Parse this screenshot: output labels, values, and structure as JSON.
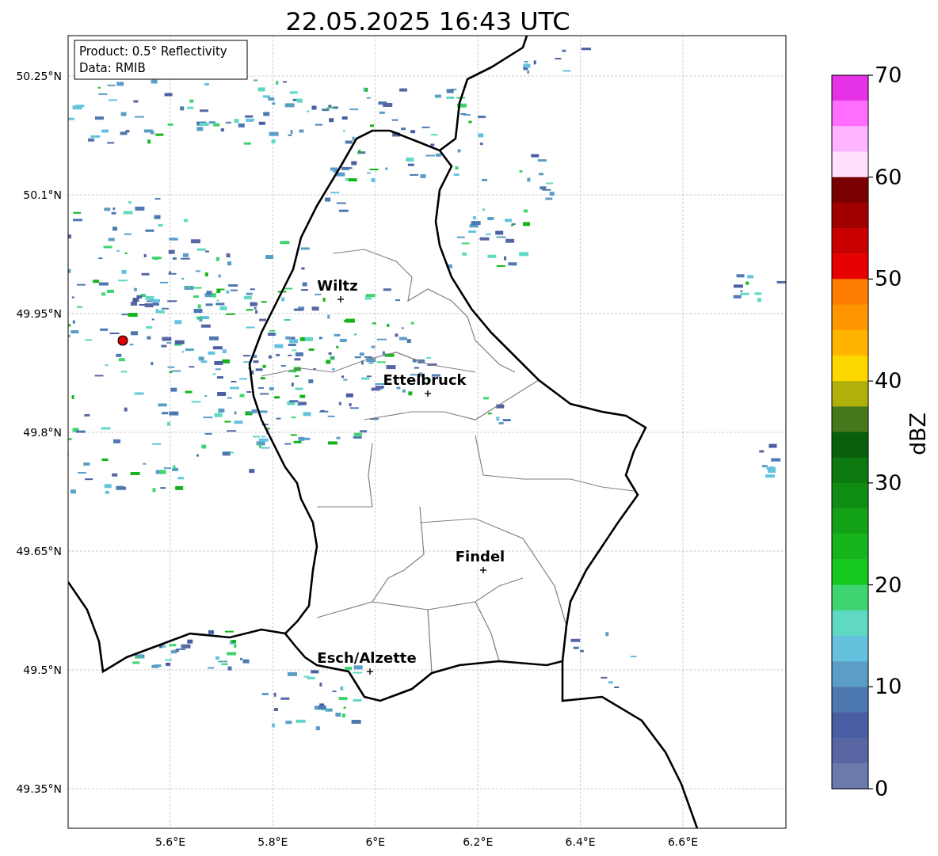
{
  "title": "22.05.2025 16:43 UTC",
  "info_box": [
    "Product: 0.5° Reflectivity",
    "Data: RMIB"
  ],
  "lat_labels": [
    "50.25°N",
    "50.1°N",
    "49.95°N",
    "49.8°N",
    "49.65°N",
    "49.5°N",
    "49.35°N"
  ],
  "lon_labels": [
    "5.6°E",
    "5.8°E",
    "6°E",
    "6.2°E",
    "6.4°E",
    "6.6°E"
  ],
  "cities": [
    {
      "name": "Wiltz"
    },
    {
      "name": "Ettelbruck"
    },
    {
      "name": "Findel"
    },
    {
      "name": "Esch/Alzette"
    }
  ],
  "colorbar": {
    "label": "dBZ",
    "ticks": [
      "70",
      "60",
      "50",
      "40",
      "30",
      "20",
      "10",
      "0"
    ],
    "bands": [
      {
        "color": "#e632e6"
      },
      {
        "color": "#ff6eff"
      },
      {
        "color": "#ffb4ff"
      },
      {
        "color": "#ffe0ff"
      },
      {
        "color": "#780000"
      },
      {
        "color": "#a00000"
      },
      {
        "color": "#c80000"
      },
      {
        "color": "#e60000"
      },
      {
        "color": "#ff7d00"
      },
      {
        "color": "#ff9600"
      },
      {
        "color": "#ffb400"
      },
      {
        "color": "#ffd700"
      },
      {
        "color": "#b0b00a"
      },
      {
        "color": "#45781a"
      },
      {
        "color": "#0a5f0c"
      },
      {
        "color": "#0c780f"
      },
      {
        "color": "#0f8c12"
      },
      {
        "color": "#12a016"
      },
      {
        "color": "#14b41a"
      },
      {
        "color": "#14c81e"
      },
      {
        "color": "#3ed46f"
      },
      {
        "color": "#5fd8c4"
      },
      {
        "color": "#65c2de"
      },
      {
        "color": "#5a9ec8"
      },
      {
        "color": "#4d78b0"
      },
      {
        "color": "#4a5fa3"
      },
      {
        "color": "#5867a4"
      },
      {
        "color": "#6a7aad"
      }
    ]
  }
}
